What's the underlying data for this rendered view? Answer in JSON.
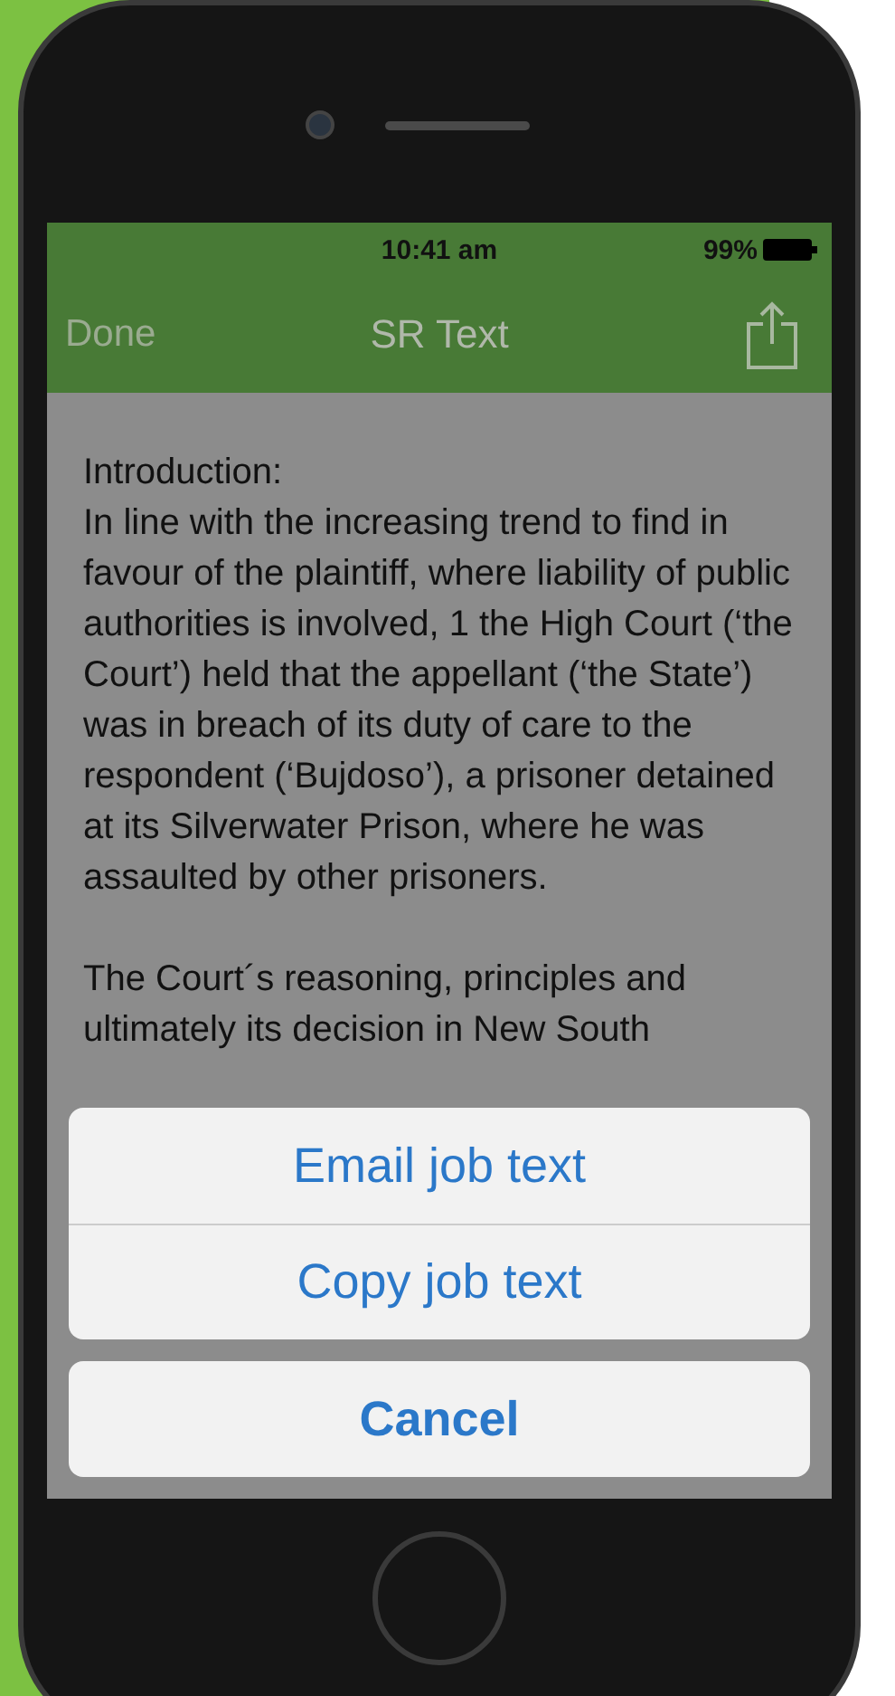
{
  "status_bar": {
    "time": "10:41 am",
    "battery": "99%"
  },
  "nav_bar": {
    "left_button": "Done",
    "title": "SR Text"
  },
  "document": {
    "paragraphs": [
      "Introduction:\nIn line with the increasing trend to find in favour of the plaintiff, where liability of public authorities is involved, 1 the High Court (‘the Court’) held that the appellant (‘the State’) was in breach of its duty of care to the respondent (‘Bujdoso’), a prisoner detained at its Silverwater Prison, where he was assaulted by other prisoners.",
      "The Court´s reasoning, principles and ultimately its decision in New South"
    ]
  },
  "action_sheet": {
    "actions": [
      "Email job text",
      "Copy job text"
    ],
    "cancel": "Cancel"
  }
}
